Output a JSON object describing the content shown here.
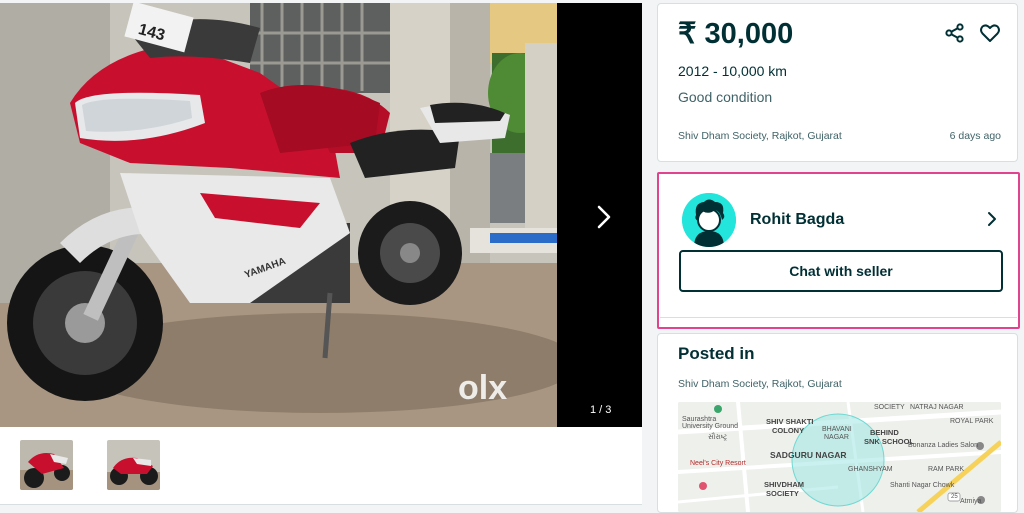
{
  "gallery": {
    "counter": "1 / 3",
    "watermark": "olx",
    "plate_text": "143",
    "bike_brand": "YAMAHA"
  },
  "listing": {
    "price": "₹ 30,000",
    "meta": "2012 - 10,000 km",
    "condition": "Good condition",
    "location": "Shiv Dham Society, Rajkot, Gujarat",
    "posted_ago": "6 days ago"
  },
  "seller": {
    "name": "Rohit Bagda",
    "chat_label": "Chat with seller"
  },
  "posted": {
    "title": "Posted in",
    "location": "Shiv Dham Society, Rajkot, Gujarat"
  },
  "map": {
    "labels": {
      "university": "Saurashtra\nUniversity Ground",
      "university_local": "સૌરાષ્ટ્ર",
      "shiv_shakti": "SHIV SHAKTI",
      "colony": "COLONY",
      "bhavani": "BHAVANI",
      "nagar": "NAGAR",
      "society": "SOCIETY",
      "natraj": "NATRAJ NAGAR",
      "royal_park": "ROYAL PARK",
      "behind": "BEHIND",
      "snk_school": "SNK SCHOOL",
      "bonanza": "Bonanza Ladies Salon",
      "sadguru": "SADGURU NAGAR",
      "ram_park": "RAM PARK",
      "neel": "Neel's City Resort",
      "shivdham": "SHIVDHAM",
      "shivdham_society": "SOCIETY",
      "ghanshyam": "GHANSHYAM",
      "shanti_nagar": "Shanti Nagar Chowk",
      "atmiya": "Atmiya",
      "highway": "25"
    }
  },
  "colors": {
    "primary": "#002f34",
    "highlight_border": "#e0448f",
    "avatar_bg": "#23e5db",
    "bike_red": "#c8102e"
  }
}
